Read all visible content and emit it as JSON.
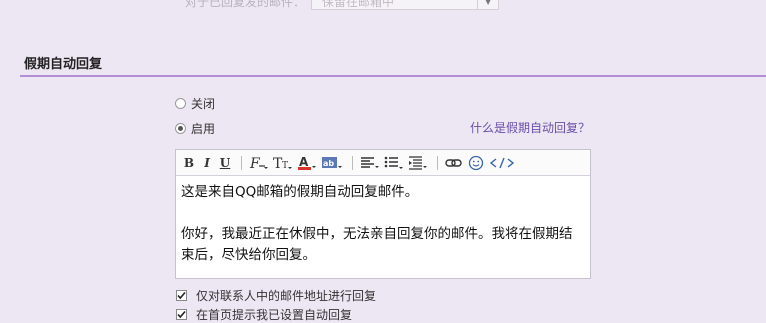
{
  "top": {
    "label": "对于已回复发的邮件：",
    "select_value": "保留在邮箱中"
  },
  "section": {
    "title": "假期自动回复"
  },
  "options": {
    "off_label": "关闭",
    "on_label": "启用",
    "selected": "on"
  },
  "help_link": "什么是假期自动回复？",
  "editor": {
    "toolbar": {
      "bold": "B",
      "italic": "I",
      "underline": "U"
    },
    "lines": [
      "这是来自QQ邮箱的假期自动回复邮件。",
      "你好，我最近正在休假中，无法亲自回复你的邮件。我将在假期结",
      "束后，尽快给你回复。"
    ]
  },
  "checkboxes": [
    {
      "label": "仅对联系人中的邮件地址进行回复",
      "checked": true
    },
    {
      "label": "在首页提示我已设置自动回复",
      "checked": true
    }
  ],
  "colors": {
    "accent_line": "#b48fd6",
    "link": "#6a4fa8",
    "background": "#ede6f3"
  }
}
